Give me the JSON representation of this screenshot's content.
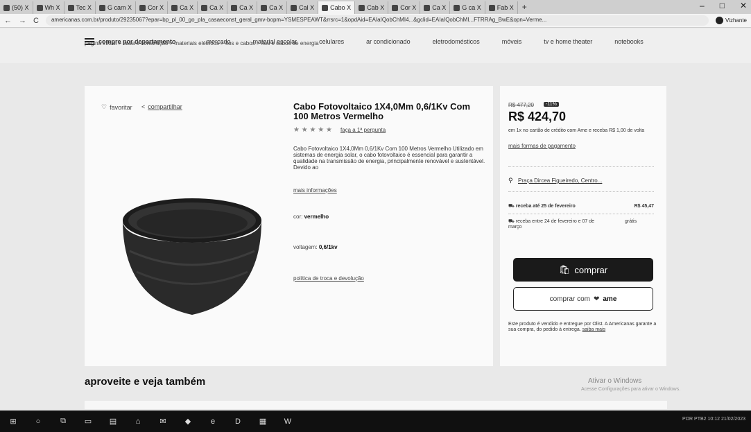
{
  "browser": {
    "tabs": [
      {
        "label": "(50) X"
      },
      {
        "label": "Wh X"
      },
      {
        "label": "Tec X"
      },
      {
        "label": "G cam X"
      },
      {
        "label": "Cor X"
      },
      {
        "label": "Ca X"
      },
      {
        "label": "Ca X"
      },
      {
        "label": "Ca X"
      },
      {
        "label": "Ca X"
      },
      {
        "label": "Cal X"
      },
      {
        "label": "Cabo X"
      },
      {
        "label": "Cab X"
      },
      {
        "label": "Cor X"
      },
      {
        "label": "Ca X"
      },
      {
        "label": "G ca X"
      },
      {
        "label": "Fab X"
      }
    ],
    "url": "americanas.com.br/produto/29235067?epar=bp_pl_00_go_pla_casaeconst_geral_gmv-bopm=YSMESPEAWT&rrsrc=1&opdAid=EAIaIQobChMI4...&gclid=EAIaIQobChMI...FTRRAg_BwE&opn=Verme...",
    "profile": "Vizhante"
  },
  "header": {
    "departments": "compre por departamento",
    "menu": [
      "mercado",
      "material escolar",
      "celulares",
      "ar condicionado",
      "eletrodomésticos",
      "móveis",
      "tv e home theater",
      "notebooks"
    ]
  },
  "breadcrumb": "página inicial  >  casa e construção  >  materiais elétricos  >  fios e cabos  >  fios e cabos de energia",
  "product": {
    "favorite": "favoritar",
    "share": "compartilhar",
    "title": "Cabo Fotovoltaico 1X4,0Mm 0,6/1Kv Com 100 Metros Vermelho",
    "stars": "★ ★ ★ ★ ★",
    "question": "faça a 1ª pergunta",
    "description": "Cabo Fotovoltaico 1X4,0Mm 0,6/1Kv Com 100 Metros Vermelho Utilizado em sistemas de energia solar, o cabo fotovoltaico é essencial para garantir a qualidade na transmissão de energia, principalmente renovável e sustentável. Devido ao",
    "more_info": "mais informações",
    "color_label": "cor:",
    "color_value": "vermelho",
    "voltage_label": "voltagem:",
    "voltage_value": "0,6/1kv",
    "policy": "política de troca e devolução"
  },
  "buy": {
    "old_price": "R$ 477,20",
    "discount": "-11%",
    "price": "R$ 424,70",
    "card_offer": "em 1x no cartão de crédito com Ame e receba R$ 1,00 de volta",
    "payment_forms": "mais formas de pagamento",
    "store": "Praça Dircea Figueiredo, Centro...",
    "ship1_label": "receba até 25 de fevereiro",
    "ship1_price": "R$ 45,47",
    "ship2_label": "receba entre 24 de fevereiro e 07 de março",
    "ship2_price": "grátis",
    "buy_label": "comprar",
    "ame_prefix": "comprar com",
    "ame_brand": "ame",
    "seller_note": "Este produto é vendido e entregue por Olist. A Americanas garante a sua compra, do pedido à entrega.",
    "seller_link": "saiba mais"
  },
  "section": {
    "title": "aproveite e veja também",
    "activate": "Ativar o Windows",
    "activate_sub": "Acesse Configurações para ativar o Windows."
  },
  "taskbar": {
    "tray": "POR  PTB2   10:12   21/02/2023"
  }
}
